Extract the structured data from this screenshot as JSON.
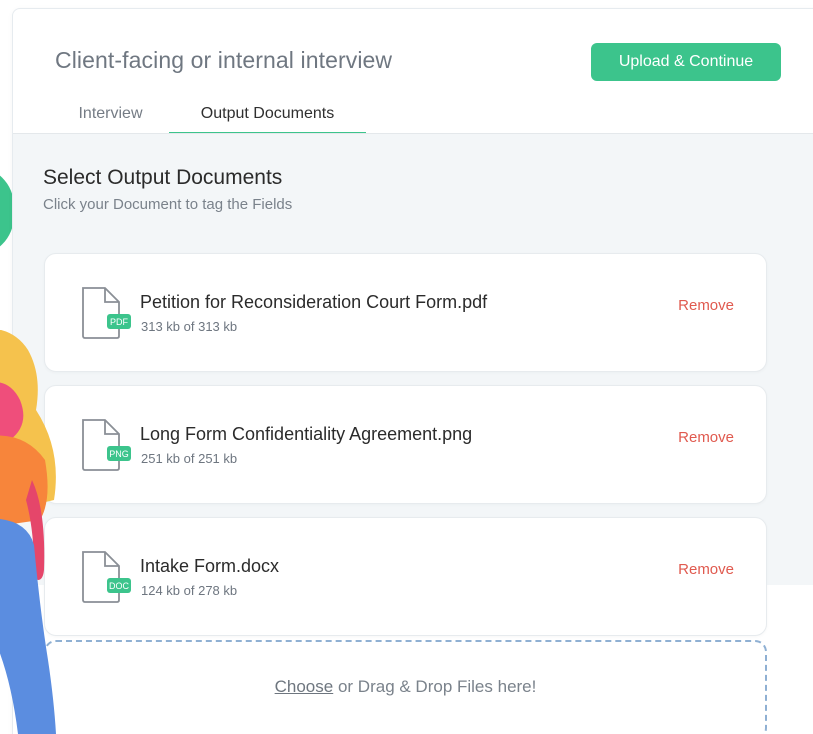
{
  "header": {
    "title": "Client-facing or internal interview",
    "upload_button": "Upload & Continue"
  },
  "tabs": [
    {
      "label": "Interview",
      "active": false
    },
    {
      "label": "Output Documents",
      "active": true
    }
  ],
  "section": {
    "title": "Select Output Documents",
    "subtitle": "Click your Document to tag the Fields"
  },
  "documents": [
    {
      "name": "Petition for Reconsideration Court Form.pdf",
      "type": "PDF",
      "size": "313 kb of 313 kb",
      "remove_label": "Remove"
    },
    {
      "name": "Long Form Confidentiality Agreement.png",
      "type": "PNG",
      "size": "251 kb of 251 kb",
      "remove_label": "Remove"
    },
    {
      "name": "Intake Form.docx",
      "type": "DOC",
      "size": "124 kb of 278 kb",
      "remove_label": "Remove"
    }
  ],
  "drop_zone": {
    "choose_label": "Choose",
    "rest_label": " or Drag & Drop Files here!"
  },
  "colors": {
    "accent": "#3cc48c",
    "remove": "#e05a4f",
    "dashed_border": "#8fb0d3"
  },
  "icons": [
    "file-pdf-icon",
    "file-png-icon",
    "file-doc-icon"
  ]
}
